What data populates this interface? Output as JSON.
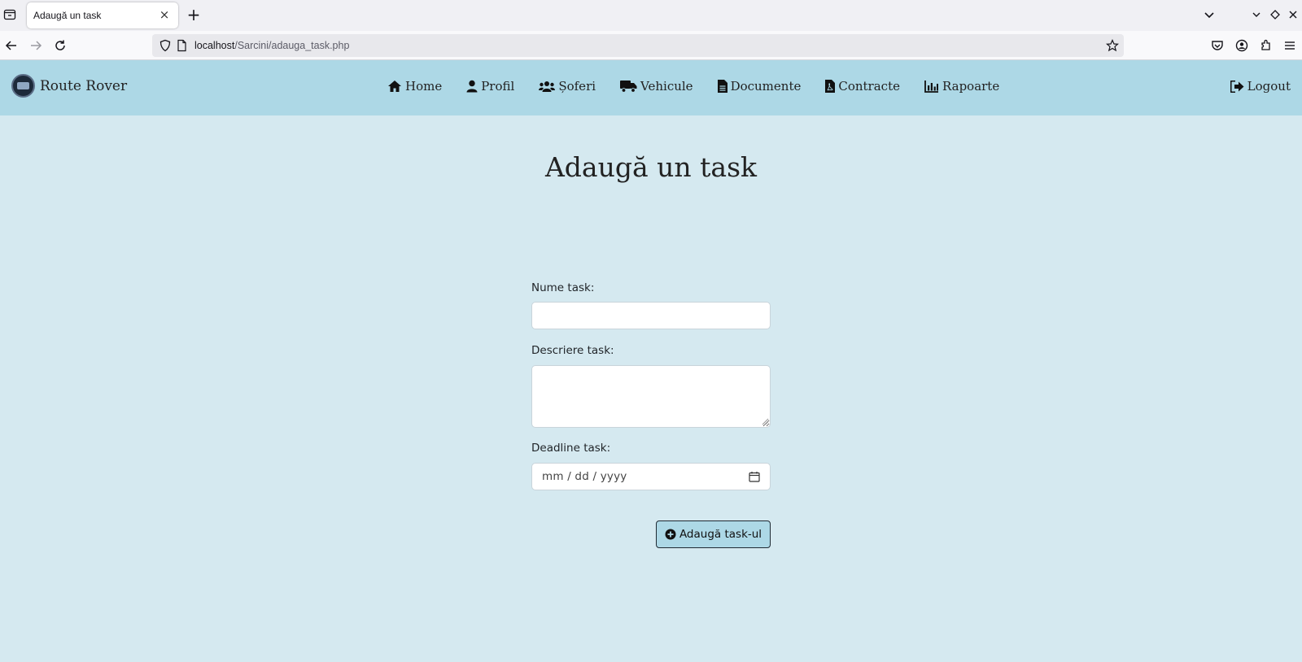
{
  "browser": {
    "tab": {
      "title": "Adaugă un task",
      "close": "×"
    },
    "new_tab": "+",
    "url": {
      "host": "localhost",
      "path": "/Sarcini/adauga_task.php"
    }
  },
  "site": {
    "brand": "Route Rover",
    "menu": [
      {
        "label": "Home",
        "icon": "home-icon"
      },
      {
        "label": "Profil",
        "icon": "user-icon"
      },
      {
        "label": "Șoferi",
        "icon": "users-icon"
      },
      {
        "label": "Vehicule",
        "icon": "truck-icon"
      },
      {
        "label": "Documente",
        "icon": "document-icon"
      },
      {
        "label": "Contracte",
        "icon": "pdf-file-icon"
      },
      {
        "label": "Rapoarte",
        "icon": "bar-chart-icon"
      }
    ],
    "logout": "Logout"
  },
  "page": {
    "title": "Adaugă un task",
    "form": {
      "name_label": "Nume task:",
      "name_value": "",
      "description_label": "Descriere task:",
      "description_value": "",
      "deadline_label": "Deadline task:",
      "deadline_placeholder": "mm / dd / yyyy",
      "submit_label": "Adaugă task-ul"
    }
  },
  "colors": {
    "header_bg": "#add8e6",
    "page_bg": "#d5e9f0",
    "button_bg": "#add8e6"
  }
}
